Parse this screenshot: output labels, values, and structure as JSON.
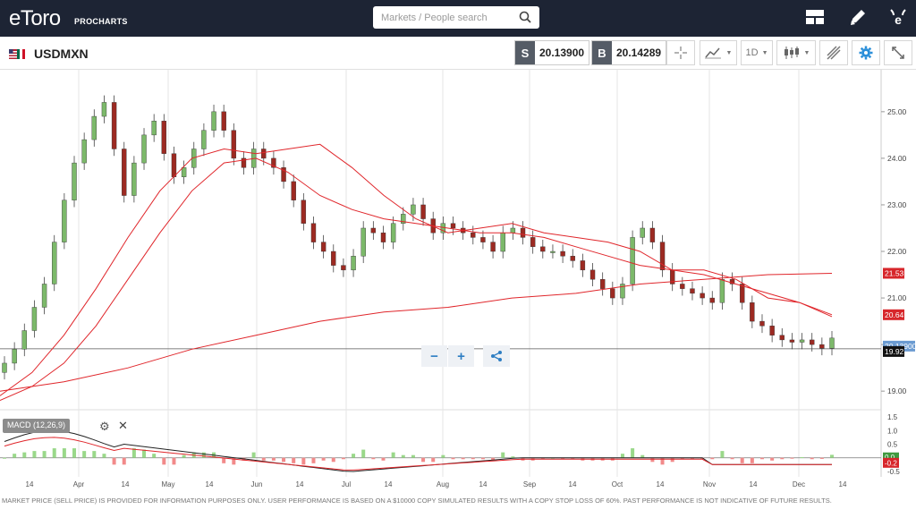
{
  "app": {
    "logo": "eToro",
    "logo_sub": "PROCHARTS"
  },
  "search": {
    "placeholder": "Markets / People search"
  },
  "top_icons": [
    "layout-icon",
    "pen-icon",
    "etoro-menu-icon"
  ],
  "instrument": {
    "symbol": "USDMXN",
    "flag": "usd-mxn-flag-icon"
  },
  "prices": {
    "sell_tag": "S",
    "sell": "20.13900",
    "buy_tag": "B",
    "buy": "20.14289"
  },
  "toolbar": {
    "timeframe": "1D"
  },
  "chart_data": {
    "type": "line",
    "title": "",
    "x": [
      "Apr",
      "May",
      "Jun",
      "Jul",
      "Aug",
      "Sep",
      "Oct",
      "Nov",
      "Dec"
    ],
    "x_ticks": [
      "14",
      "Apr",
      "14",
      "May",
      "14",
      "Jun",
      "14",
      "Jul",
      "14",
      "Aug",
      "14",
      "Sep",
      "14",
      "Oct",
      "14",
      "Nov",
      "14",
      "Dec",
      "14"
    ],
    "y_ticks": [
      "25.00",
      "24.00",
      "23.00",
      "22.00",
      "21.00",
      "20.00",
      "19.00"
    ],
    "ylim": [
      18.6,
      25.9
    ],
    "close_series": [
      19.6,
      19.9,
      20.3,
      20.8,
      21.3,
      22.2,
      23.1,
      23.9,
      24.4,
      24.9,
      25.2,
      24.2,
      23.2,
      23.9,
      24.5,
      24.8,
      24.1,
      23.6,
      23.8,
      24.2,
      24.6,
      25.0,
      24.6,
      24.0,
      23.8,
      24.2,
      24.0,
      23.8,
      23.5,
      23.1,
      22.6,
      22.2,
      22.0,
      21.7,
      21.6,
      21.9,
      22.5,
      22.4,
      22.2,
      22.6,
      22.8,
      23.0,
      22.7,
      22.4,
      22.6,
      22.5,
      22.4,
      22.3,
      22.2,
      22.0,
      22.4,
      22.5,
      22.3,
      22.1,
      22.0,
      22.0,
      21.9,
      21.8,
      21.6,
      21.4,
      21.2,
      21.0,
      21.3,
      22.3,
      22.5,
      22.2,
      21.6,
      21.3,
      21.2,
      21.1,
      21.0,
      20.9,
      21.4,
      21.3,
      20.9,
      20.5,
      20.4,
      20.2,
      20.1,
      20.05,
      20.1,
      20.0,
      19.92,
      20.14
    ],
    "series": [
      {
        "name": "",
        "values": [
          18.9,
          19.4,
          20.2,
          21.2,
          22.3,
          23.3,
          24.0,
          24.2,
          24.1,
          24.2,
          24.3,
          23.8,
          23.2,
          22.7,
          22.4,
          22.5,
          22.6,
          22.4,
          22.3,
          22.2,
          22.0,
          21.6,
          21.6,
          21.4,
          21.0,
          20.9,
          20.6
        ]
      },
      {
        "name": "",
        "values": [
          18.8,
          19.1,
          19.6,
          20.4,
          21.4,
          22.4,
          23.3,
          23.9,
          24.0,
          23.7,
          23.2,
          22.9,
          22.7,
          22.6,
          22.5,
          22.4,
          22.4,
          22.3,
          22.1,
          21.9,
          21.7,
          21.6,
          21.5,
          21.3,
          21.1,
          20.9,
          20.64
        ]
      },
      {
        "name": "",
        "values": [
          19.0,
          19.2,
          19.5,
          19.9,
          20.2,
          20.5,
          20.7,
          20.8,
          21.0,
          21.1,
          21.3,
          21.4,
          21.5,
          21.53
        ]
      }
    ],
    "axis_tags": [
      {
        "label": "21.53",
        "color": "#d7262b"
      },
      {
        "label": "20.64",
        "color": "#d7262b"
      },
      {
        "label": "20.13900",
        "color": "#6b9bd1"
      },
      {
        "label": "19.92",
        "color": "#111111"
      }
    ],
    "macd": {
      "label": "MACD (12,26,9)",
      "y_ticks": [
        "1.5",
        "1.0",
        "0.5",
        "0.0",
        "-0.5"
      ],
      "tags": [
        {
          "label": "0.0",
          "color": "#3f9a3f"
        },
        {
          "label": "-0.2",
          "color": "#d7262b"
        }
      ]
    }
  },
  "footer": {
    "disclaimer": "MARKET PRICE (SELL PRICE) IS PROVIDED FOR INFORMATION PURPOSES ONLY. USER PERFORMANCE IS BASED ON A $10000 COPY SIMULATED RESULTS WITH A COPY STOP LOSS OF 60%. PAST PERFORMANCE IS NOT INDICATIVE OF FUTURE RESULTS."
  }
}
